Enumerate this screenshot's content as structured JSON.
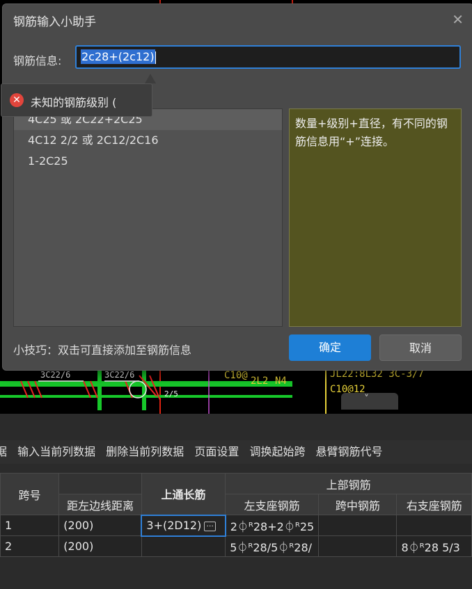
{
  "dialog": {
    "title": "钢筋输入小助手",
    "close_glyph": "✕",
    "info_label": "钢筋信息:",
    "info_value": "2c28+(2c12)",
    "error": {
      "icon": "error-x-icon",
      "glyph": "✕",
      "message": "未知的钢筋级别 ("
    },
    "examples": [
      "4C25 或 2C22+2C25",
      "4C12 2/2 或 2C12/2C16",
      "1-2C25"
    ],
    "description": "数量+级别+直径，有不同的钢筋信息用“+”连接。",
    "tip": "小技巧：双击可直接添加至钢筋信息",
    "ok_label": "确定",
    "cancel_label": "取消"
  },
  "cad": {
    "labels": [
      "3C22/6",
      "3C22/6",
      "C10@",
      "2L2",
      "N4",
      "2/5",
      "JL22:8L32 3C-3/7",
      "C10@12"
    ],
    "collapse_glyph": "˅"
  },
  "toolbar": {
    "items": [
      "据",
      "输入当前列数据",
      "删除当前列数据",
      "页面设置",
      "调换起始跨",
      "悬臂钢筋代号"
    ]
  },
  "table": {
    "headers": {
      "span_no": "跨号",
      "left_dist": "距左边线距离",
      "top_long": "上通长筋",
      "top_rebar": "上部钢筋",
      "left_support": "左支座钢筋",
      "mid_span": "跨中钢筋",
      "right_support": "右支座钢筋"
    },
    "rows": [
      {
        "no": "1",
        "dist": "(200)",
        "top_long": "3+(2D12)",
        "left": "2⏀ᴿ28+2⏀ᴿ25",
        "mid": "",
        "right": ""
      },
      {
        "no": "2",
        "dist": "(200)",
        "top_long": "",
        "left": "5⏀ᴿ28/5⏀ᴿ28/",
        "mid": "",
        "right": "8⏀ᴿ28 5/3"
      }
    ],
    "ellipsis_glyph": "···"
  }
}
